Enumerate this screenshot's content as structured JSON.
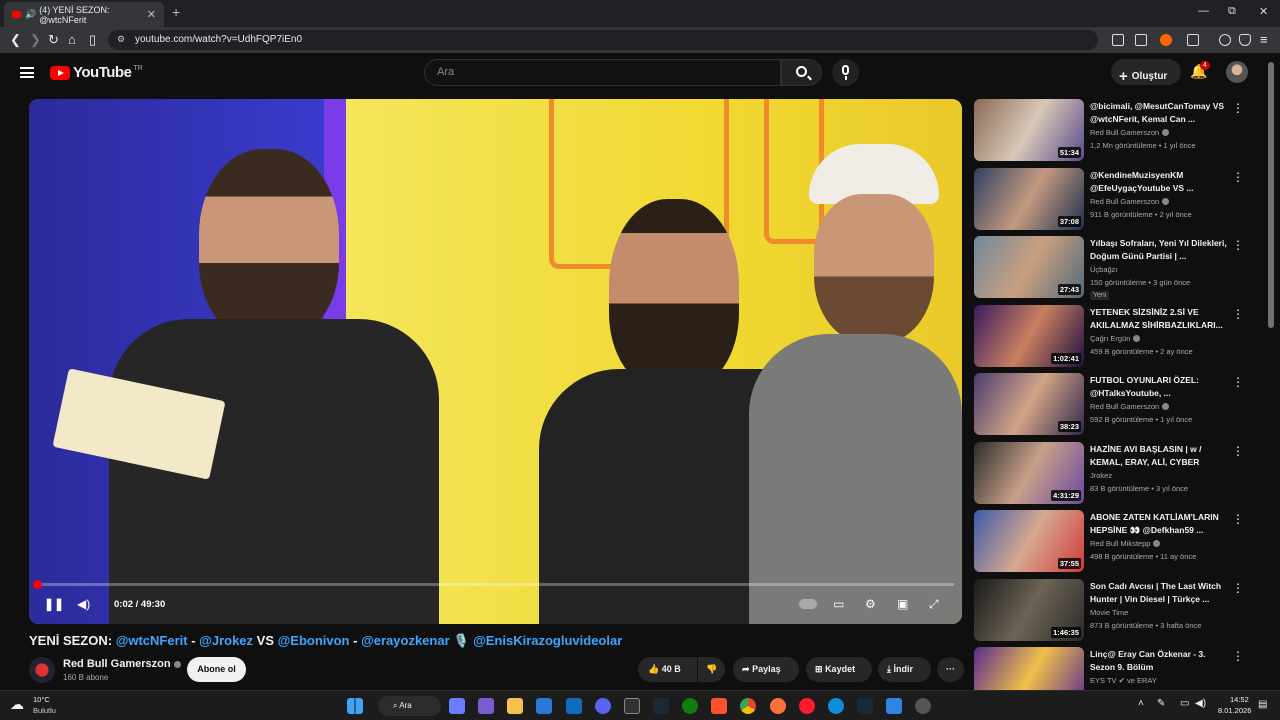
{
  "browser": {
    "tab_title": "(4) YENİ SEZON: @wtcNFerit",
    "tab_close": "✕",
    "new_tab": "+",
    "url": "youtube.com/watch?v=UdhFQP7iEn0",
    "win_min": "—",
    "win_max": "⧉",
    "win_close": "✕"
  },
  "youtube": {
    "logo_text": "YouTube",
    "country_code": "TR",
    "search_placeholder": "Ara",
    "create_label": "Oluştur",
    "notification_count": "4"
  },
  "player": {
    "current_time": "0:02",
    "duration": "49:30",
    "time_display": "0:02 / 49:30",
    "progress_fraction": 0.0007
  },
  "video": {
    "title_prefix": "YENİ SEZON: ",
    "tag1": "@wtcNFerit",
    "sep1": " - ",
    "tag2": "@Jrokez",
    "sep2": " VS ",
    "tag3": "@Ebonivon",
    "sep3": " - ",
    "tag4": "@erayozkenar",
    "sep4": " 🎙️ ",
    "tag5": "@EnisKirazogluvideolar",
    "channel_name": "Red Bull Gamerszon",
    "subscribers": "160 B abone",
    "subscribe_label": "Abone ol",
    "likes": "40 B",
    "share_label": "Paylaş",
    "save_label": "Kaydet",
    "download_label": "İndir",
    "more": "···"
  },
  "recommendations": [
    {
      "title": "@bicimali, @MesutCanTomay VS @wtcNFerit, Kemal Can ...",
      "channel": "Red Bull Gamerszon",
      "verified": true,
      "meta": "1,2 Mn görüntüleme • 1 yıl önce",
      "duration": "51:34",
      "badge": ""
    },
    {
      "title": "@KendineMuzisyenKM @EfeUygaçYoutube  VS ...",
      "channel": "Red Bull Gamerszon",
      "verified": true,
      "meta": "911 B görüntüleme • 2 yıl önce",
      "duration": "37:08",
      "badge": ""
    },
    {
      "title": "Yılbaşı Sofraları, Yeni Yıl Dilekleri, Doğum Günü Partisi | ...",
      "channel": "Üçbağzı",
      "verified": false,
      "meta": "150 görüntüleme • 3 gün önce",
      "duration": "27:43",
      "badge": "Yeni"
    },
    {
      "title": "YETENEK SİZSİNİZ 2.Sİ VE AKILALMAZ SİHİRBAZLIKLARI...",
      "channel": "Çağrı Ergün",
      "verified": true,
      "meta": "459 B görüntüleme • 2 ay önce",
      "duration": "1:02:41",
      "badge": ""
    },
    {
      "title": "FUTBOL OYUNLARI ÖZEL: @HTalksYoutube, ...",
      "channel": "Red Bull Gamerszon",
      "verified": true,
      "meta": "592 B görüntüleme • 1 yıl önce",
      "duration": "38:23",
      "badge": ""
    },
    {
      "title": "HAZİNE AVI  BAŞLASIN | w / KEMAL, ERAY, ALİ, CYBER",
      "channel": "Jrokez",
      "verified": false,
      "meta": "83 B görüntüleme • 3 yıl önce",
      "duration": "4:31:29",
      "badge": ""
    },
    {
      "title": "ABONE ZATEN KATLİAM'LARIN HEPSİNE 👀 @Defkhan59 ...",
      "channel": "Red Bull Mikstepp",
      "verified": true,
      "meta": "498 B görüntüleme • 11 ay önce",
      "duration": "37:55",
      "badge": ""
    },
    {
      "title": "Son Cadı Avcısı | The Last Witch Hunter | Vin Diesel | Türkçe ...",
      "channel": "Movie Time",
      "verified": false,
      "meta": "873 B görüntüleme • 3 hafta önce",
      "duration": "1:46:35",
      "badge": ""
    },
    {
      "title": "Linç@ Eray Can Özkenar - 3. Sezon 9. Bölüm",
      "channel": "EYS TV ✔ ve ERAY",
      "verified": false,
      "meta": "",
      "duration": "",
      "badge": ""
    }
  ],
  "taskbar": {
    "weather_temp": "10°C",
    "weather_desc": "Bulutlu",
    "search_label": "Ara",
    "time": "14:52",
    "date": "8.01.2026"
  },
  "colors": {
    "accent_red": "#ff0000",
    "link_blue": "#3ea6ff",
    "background": "#0f0f0f"
  }
}
